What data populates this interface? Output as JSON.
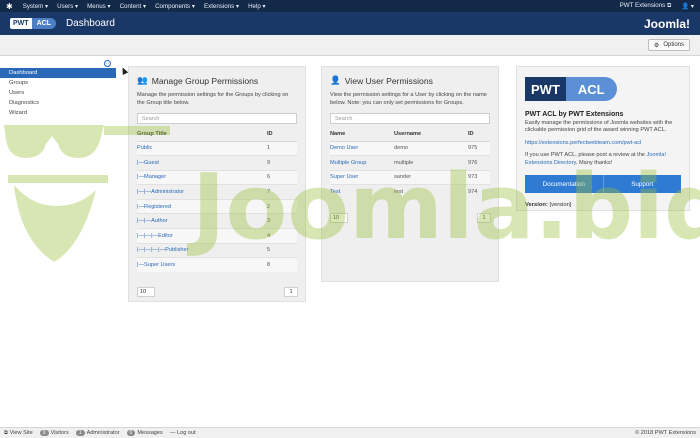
{
  "navbar": {
    "menu": [
      "System ▾",
      "Users ▾",
      "Menus ▾",
      "Content ▾",
      "Components ▾",
      "Extensions ▾",
      "Help ▾"
    ],
    "site_link": "PWT Extensions",
    "user_menu": "▾"
  },
  "header": {
    "logo_left": "PWT",
    "logo_right": "ACL",
    "title": "Dashboard",
    "brand": "Joomla!"
  },
  "toolbar": {
    "options_label": "Options"
  },
  "sidebar": {
    "items": [
      {
        "label": "Dashboard",
        "active": true
      },
      {
        "label": "Groups"
      },
      {
        "label": "Users"
      },
      {
        "label": "Diagnostics"
      },
      {
        "label": "Wizard"
      }
    ]
  },
  "groups_panel": {
    "title": "Manage Group Permissions",
    "description": "Manage the permission settings for the Groups by clicking on the Group title below.",
    "search_placeholder": "Search",
    "columns": [
      "Group Title",
      "ID"
    ],
    "rows": [
      {
        "title": "Public",
        "id": "1"
      },
      {
        "title": "|—Guest",
        "id": "9"
      },
      {
        "title": "|—Manager",
        "id": "6"
      },
      {
        "title": "|—|—Administrator",
        "id": "7"
      },
      {
        "title": "|—Registered",
        "id": "2"
      },
      {
        "title": "|—|—Author",
        "id": "3"
      },
      {
        "title": "|—|—|—Editor",
        "id": "4"
      },
      {
        "title": "|—|—|—|—Publisher",
        "id": "5"
      },
      {
        "title": "|—Super Users",
        "id": "8"
      }
    ],
    "limit": "10",
    "page": "1"
  },
  "users_panel": {
    "title": "View User Permissions",
    "description": "View the permission settings for a User by clicking on the name below. Note: you can only set permissions for Groups.",
    "search_placeholder": "Search",
    "columns": [
      "Name",
      "Username",
      "ID"
    ],
    "rows": [
      {
        "name": "Demo User",
        "username": "demo",
        "id": "975"
      },
      {
        "name": "Multiple Group",
        "username": "multiple",
        "id": "976"
      },
      {
        "name": "Super User",
        "username": "sander",
        "id": "973"
      },
      {
        "name": "Test",
        "username": "test",
        "id": "974"
      }
    ],
    "limit": "10",
    "page": "1"
  },
  "info_panel": {
    "logo_left": "PWT",
    "logo_right": "ACL",
    "title": "PWT ACL by PWT Extensions",
    "description": "Easily manage the permissions of Joomla websites with the clickable permission grid of the award winning PWT ACL.",
    "link": "https://extensions.perfectwebteam.com/pwt-acl",
    "review_text": "If you use PWT ACL, please post a review at the",
    "review_link": "Joomla! Extensions Directory",
    "review_suffix": ". Many thanks!",
    "doc_button": "Documentation",
    "support_button": "Support",
    "version_label": "Version:",
    "version_value": "[version]"
  },
  "watermark": {
    "text": "Joomla.bid"
  },
  "statusbar": {
    "view_site": "View Site",
    "visitors_count": "0",
    "visitors_label": "Visitors",
    "admin_count": "1",
    "admin_label": "Administrator",
    "messages_count": "0",
    "messages_label": "Messages",
    "logout": "Log out",
    "copyright": "© 2018 PWT Extensions"
  },
  "colors": {
    "navbar": "#13294a",
    "header": "#1a3867",
    "accent": "#2a69b8",
    "button": "#2f7bd4",
    "watermark": "#9bbf3a"
  }
}
